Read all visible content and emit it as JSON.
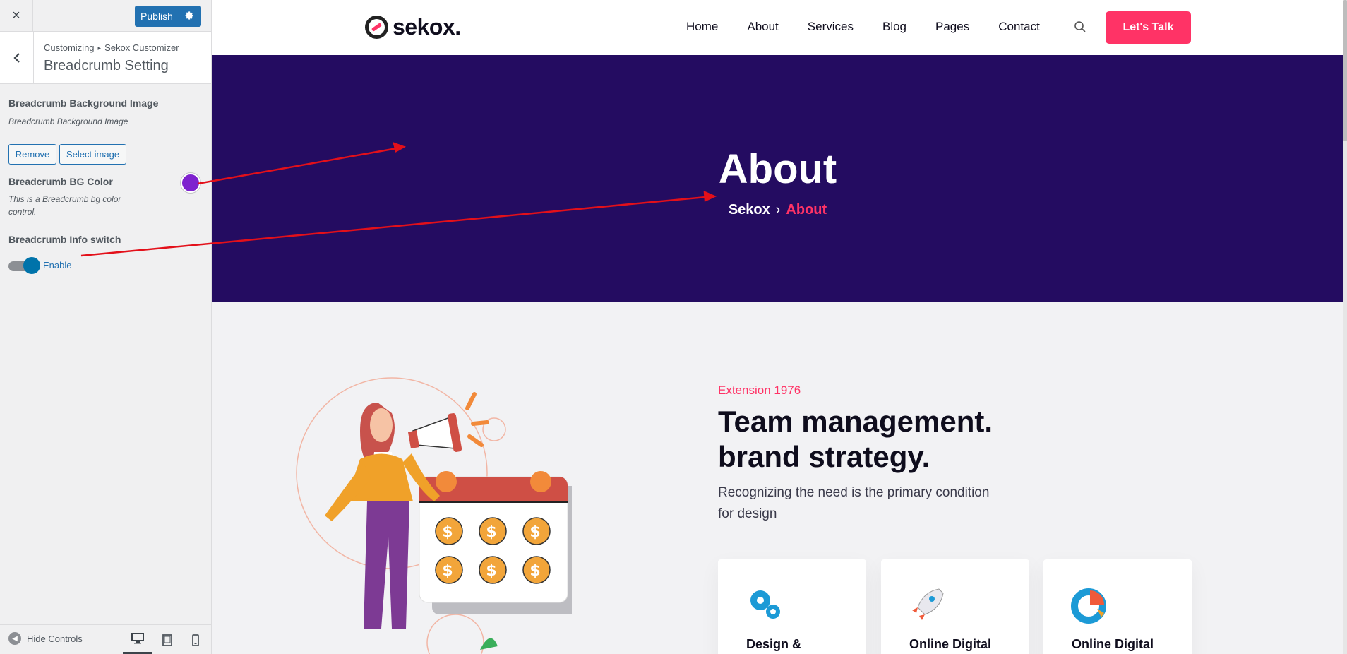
{
  "customizer": {
    "close_label": "×",
    "publish_label": "Publish",
    "breadcrumb": [
      "Customizing",
      "Sekox Customizer"
    ],
    "breadcrumb_sep": "▸",
    "section_title": "Breadcrumb Setting",
    "controls": {
      "bg_image_title": "Breadcrumb Background Image",
      "bg_image_desc": "Breadcrumb Background Image",
      "remove_label": "Remove",
      "select_image_label": "Select image",
      "bg_color_title": "Breadcrumb BG Color",
      "bg_color_desc": "This is a Breadcrumb bg color control.",
      "bg_color_value": "#7e22ce",
      "info_switch_title": "Breadcrumb Info switch",
      "info_switch_label": "Enable",
      "info_switch_on": true
    },
    "footer": {
      "hide_controls_label": "Hide Controls",
      "devices": [
        "desktop-icon",
        "tablet-icon",
        "mobile-icon"
      ],
      "active_device": "desktop"
    }
  },
  "site": {
    "logo_text": "sekox.",
    "nav": [
      "Home",
      "About",
      "Services",
      "Blog",
      "Pages",
      "Contact"
    ],
    "cta_label": "Let's Talk",
    "hero": {
      "title": "About",
      "crumb_home": "Sekox",
      "crumb_sep": "›",
      "crumb_current": "About",
      "bg_color": "#240c61"
    },
    "about": {
      "kicker": "Extension 1976",
      "headline_line1": "Team management.",
      "headline_line2": "brand strategy.",
      "lead": "Recognizing the need is the primary condition for design",
      "cards": [
        "Design &",
        "Online Digital",
        "Online Digital"
      ]
    }
  },
  "colors": {
    "accent": "#ff3366",
    "wp_blue": "#2271b1",
    "hero_bg": "#240c61",
    "annotation_arrow": "#e3101a"
  }
}
